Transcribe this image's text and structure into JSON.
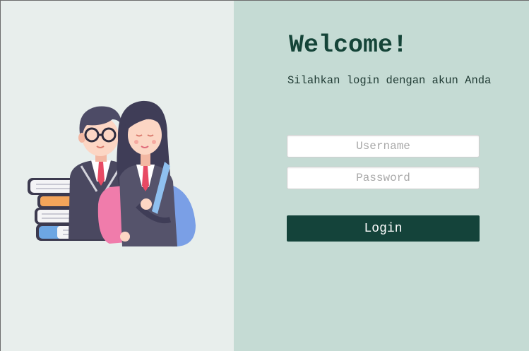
{
  "login": {
    "title": "Welcome!",
    "subtitle": "Silahkan login dengan akun Anda",
    "username_placeholder": "Username",
    "password_placeholder": "Password",
    "button_label": "Login"
  },
  "colors": {
    "left_panel_bg": "#e8eeec",
    "right_panel_bg": "#c5dbd4",
    "accent": "#14433a",
    "title_text": "#154438"
  },
  "illustration": {
    "icon": "students-with-books-illustration"
  }
}
